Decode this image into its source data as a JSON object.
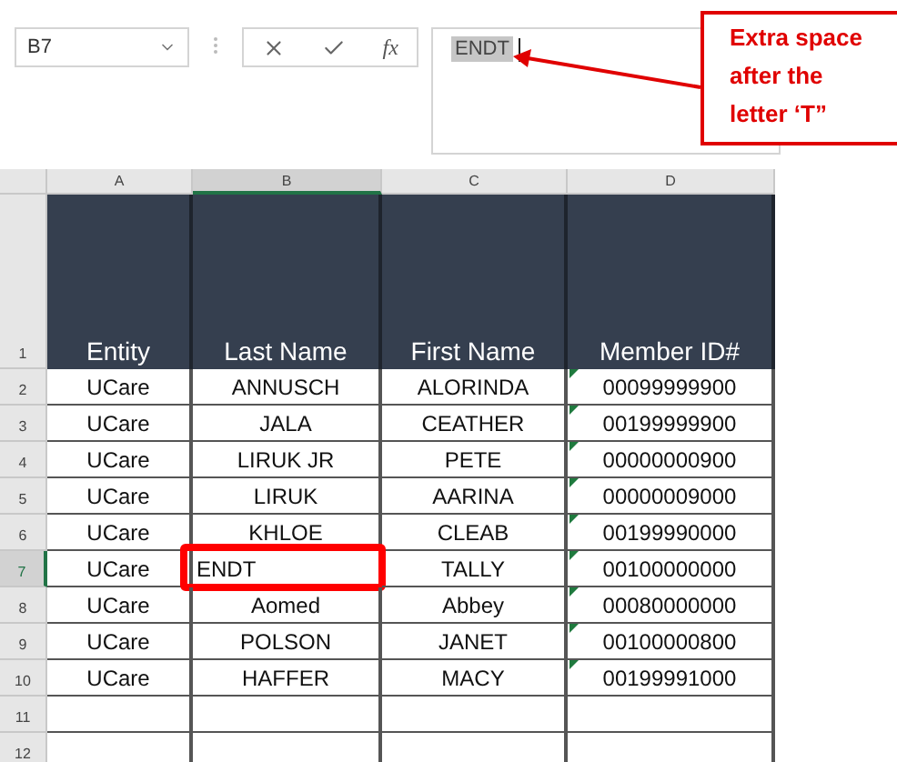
{
  "name_box": {
    "value": "B7"
  },
  "formula_bar": {
    "function_label": "fx",
    "value": "ENDT",
    "value_highlighted": true
  },
  "callout": {
    "text": "Extra space after the letter ‘T”"
  },
  "columns": [
    {
      "label": "A",
      "selected": false
    },
    {
      "label": "B",
      "selected": true
    },
    {
      "label": "C",
      "selected": false
    },
    {
      "label": "D",
      "selected": false
    }
  ],
  "header_row": {
    "number": "1",
    "cells": [
      "Entity",
      "Last Name",
      "First Name",
      "Member ID#"
    ]
  },
  "rows": [
    {
      "number": "2",
      "selected": false,
      "flagged": true,
      "cells": [
        {
          "text": "UCare",
          "active": false
        },
        {
          "text": "ANNUSCH",
          "active": false
        },
        {
          "text": "ALORINDA",
          "active": false
        },
        {
          "text": "00099999900",
          "active": false
        }
      ]
    },
    {
      "number": "3",
      "selected": false,
      "flagged": true,
      "cells": [
        {
          "text": "UCare",
          "active": false
        },
        {
          "text": "JALA",
          "active": false
        },
        {
          "text": "CEATHER",
          "active": false
        },
        {
          "text": "00199999900",
          "active": false
        }
      ]
    },
    {
      "number": "4",
      "selected": false,
      "flagged": true,
      "cells": [
        {
          "text": "UCare",
          "active": false
        },
        {
          "text": "LIRUK JR",
          "active": false
        },
        {
          "text": "PETE",
          "active": false
        },
        {
          "text": "00000000900",
          "active": false
        }
      ]
    },
    {
      "number": "5",
      "selected": false,
      "flagged": true,
      "cells": [
        {
          "text": "UCare",
          "active": false
        },
        {
          "text": "LIRUK",
          "active": false
        },
        {
          "text": "AARINA",
          "active": false
        },
        {
          "text": "00000009000",
          "active": false
        }
      ]
    },
    {
      "number": "6",
      "selected": false,
      "flagged": true,
      "cells": [
        {
          "text": "UCare",
          "active": false
        },
        {
          "text": "KHLOE",
          "active": false
        },
        {
          "text": "CLEAB",
          "active": false
        },
        {
          "text": "00199990000",
          "active": false
        }
      ]
    },
    {
      "number": "7",
      "selected": true,
      "flagged": true,
      "cells": [
        {
          "text": "UCare",
          "active": false
        },
        {
          "text": "ENDT",
          "active": true
        },
        {
          "text": "TALLY",
          "active": false
        },
        {
          "text": "00100000000",
          "active": false
        }
      ]
    },
    {
      "number": "8",
      "selected": false,
      "flagged": true,
      "cells": [
        {
          "text": "UCare",
          "active": false
        },
        {
          "text": "Aomed",
          "active": false
        },
        {
          "text": "Abbey",
          "active": false
        },
        {
          "text": "00080000000",
          "active": false
        }
      ]
    },
    {
      "number": "9",
      "selected": false,
      "flagged": true,
      "cells": [
        {
          "text": "UCare",
          "active": false
        },
        {
          "text": "POLSON",
          "active": false
        },
        {
          "text": "JANET",
          "active": false
        },
        {
          "text": "00100000800",
          "active": false
        }
      ]
    },
    {
      "number": "10",
      "selected": false,
      "flagged": true,
      "cells": [
        {
          "text": "UCare",
          "active": false
        },
        {
          "text": "HAFFER",
          "active": false
        },
        {
          "text": "MACY",
          "active": false
        },
        {
          "text": "00199991000",
          "active": false
        }
      ]
    }
  ],
  "empty_rows": [
    "11",
    "12"
  ]
}
